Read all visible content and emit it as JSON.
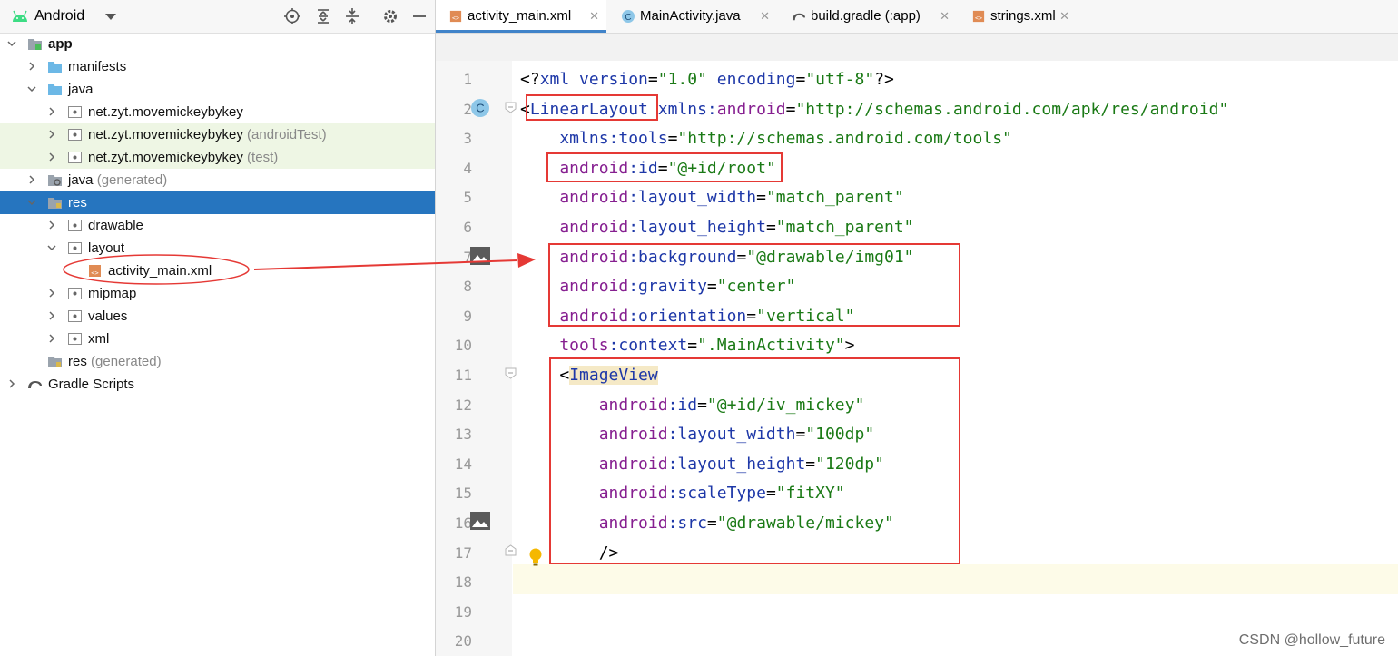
{
  "project_panel": {
    "view_name": "Android",
    "tree": [
      {
        "label": "app",
        "suffix": "",
        "level": 0,
        "expanded": true,
        "icon": "module-folder-icon",
        "bold": true
      },
      {
        "label": "manifests",
        "suffix": "",
        "level": 1,
        "expanded": false,
        "icon": "folder-icon"
      },
      {
        "label": "java",
        "suffix": "",
        "level": 1,
        "expanded": true,
        "icon": "folder-icon"
      },
      {
        "label": "net.zyt.movemickeybykey",
        "suffix": "",
        "level": 2,
        "expanded": false,
        "icon": "package-icon"
      },
      {
        "label": "net.zyt.movemickeybykey",
        "suffix": "(androidTest)",
        "level": 2,
        "expanded": false,
        "icon": "package-icon",
        "highlight": true
      },
      {
        "label": "net.zyt.movemickeybykey",
        "suffix": "(test)",
        "level": 2,
        "expanded": false,
        "icon": "package-icon",
        "highlight": true
      },
      {
        "label": "java",
        "suffix": "(generated)",
        "level": 1,
        "expanded": false,
        "icon": "generated-folder-icon"
      },
      {
        "label": "res",
        "suffix": "",
        "level": 1,
        "expanded": true,
        "icon": "res-folder-icon",
        "selected": true
      },
      {
        "label": "drawable",
        "suffix": "",
        "level": 2,
        "expanded": false,
        "icon": "package-icon"
      },
      {
        "label": "layout",
        "suffix": "",
        "level": 2,
        "expanded": true,
        "icon": "package-icon"
      },
      {
        "label": "activity_main.xml",
        "suffix": "",
        "level": 3,
        "leaf": true,
        "icon": "xml-file-icon"
      },
      {
        "label": "mipmap",
        "suffix": "",
        "level": 2,
        "expanded": false,
        "icon": "package-icon"
      },
      {
        "label": "values",
        "suffix": "",
        "level": 2,
        "expanded": false,
        "icon": "package-icon"
      },
      {
        "label": "xml",
        "suffix": "",
        "level": 2,
        "expanded": false,
        "icon": "package-icon"
      },
      {
        "label": "res",
        "suffix": "(generated)",
        "level": 1,
        "leaf": true,
        "icon": "res-folder-icon"
      },
      {
        "label": "Gradle Scripts",
        "suffix": "",
        "level": 0,
        "expanded": false,
        "icon": "gradle-icon"
      }
    ]
  },
  "editor": {
    "tabs": [
      {
        "label": "activity_main.xml",
        "icon": "xml-file-icon",
        "active": true
      },
      {
        "label": "MainActivity.java",
        "icon": "java-class-icon",
        "active": false
      },
      {
        "label": "build.gradle (:app)",
        "icon": "gradle-icon",
        "active": false
      },
      {
        "label": "strings.xml",
        "icon": "xml-file-icon",
        "active": false
      }
    ],
    "tab_close_glyph": "✕",
    "line_numbers": [
      "1",
      "2",
      "3",
      "4",
      "5",
      "6",
      "7",
      "8",
      "9",
      "10",
      "11",
      "12",
      "13",
      "14",
      "15",
      "16",
      "17",
      "18",
      "19",
      "20"
    ],
    "code": [
      [
        [
          "pn",
          "<?"
        ],
        [
          "at",
          "xml version"
        ],
        [
          "pn",
          "="
        ],
        [
          "sv",
          "\"1.0\""
        ],
        [
          "at",
          " encoding"
        ],
        [
          "pn",
          "="
        ],
        [
          "sv",
          "\"utf-8\""
        ],
        [
          "pn",
          "?>"
        ]
      ],
      [
        [
          "pn",
          "<"
        ],
        [
          "tg",
          "LinearLayout"
        ],
        [
          "at",
          " xmlns:"
        ],
        [
          "an",
          "android"
        ],
        [
          "pn",
          "="
        ],
        [
          "sv",
          "\"http://schemas.android.com/apk/res/android\""
        ]
      ],
      [
        [
          "at",
          "    xmlns:tools"
        ],
        [
          "pn",
          "="
        ],
        [
          "sv",
          "\"http://schemas.android.com/tools\""
        ]
      ],
      [
        [
          "an",
          "    android"
        ],
        [
          "at",
          ":id"
        ],
        [
          "pn",
          "="
        ],
        [
          "sv",
          "\"@+id/root\""
        ]
      ],
      [
        [
          "an",
          "    android"
        ],
        [
          "at",
          ":layout_width"
        ],
        [
          "pn",
          "="
        ],
        [
          "sv",
          "\"match_parent\""
        ]
      ],
      [
        [
          "an",
          "    android"
        ],
        [
          "at",
          ":layout_height"
        ],
        [
          "pn",
          "="
        ],
        [
          "sv",
          "\"match_parent\""
        ]
      ],
      [
        [
          "an",
          "    android"
        ],
        [
          "at",
          ":background"
        ],
        [
          "pn",
          "="
        ],
        [
          "sv",
          "\"@drawable/img01\""
        ]
      ],
      [
        [
          "an",
          "    android"
        ],
        [
          "at",
          ":gravity"
        ],
        [
          "pn",
          "="
        ],
        [
          "sv",
          "\"center\""
        ]
      ],
      [
        [
          "an",
          "    android"
        ],
        [
          "at",
          ":orientation"
        ],
        [
          "pn",
          "="
        ],
        [
          "sv",
          "\"vertical\""
        ]
      ],
      [
        [
          "an",
          "    tools"
        ],
        [
          "at",
          ":context"
        ],
        [
          "pn",
          "="
        ],
        [
          "sv",
          "\".MainActivity\""
        ],
        [
          "pn",
          ">"
        ]
      ],
      [
        [
          "pn",
          "    <"
        ],
        [
          "tg",
          "ImageView"
        ]
      ],
      [
        [
          "an",
          "        android"
        ],
        [
          "at",
          ":id"
        ],
        [
          "pn",
          "="
        ],
        [
          "sv",
          "\"@+id/iv_mickey\""
        ]
      ],
      [
        [
          "an",
          "        android"
        ],
        [
          "at",
          ":layout_width"
        ],
        [
          "pn",
          "="
        ],
        [
          "sv",
          "\"100dp\""
        ]
      ],
      [
        [
          "an",
          "        android"
        ],
        [
          "at",
          ":layout_height"
        ],
        [
          "pn",
          "="
        ],
        [
          "sv",
          "\"120dp\""
        ]
      ],
      [
        [
          "an",
          "        android"
        ],
        [
          "at",
          ":scaleType"
        ],
        [
          "pn",
          "="
        ],
        [
          "sv",
          "\"fitXY\""
        ]
      ],
      [
        [
          "an",
          "        android"
        ],
        [
          "at",
          ":src"
        ],
        [
          "pn",
          "="
        ],
        [
          "sv",
          "\"@drawable/mickey\""
        ]
      ],
      [
        [
          "pn",
          "        />"
        ]
      ],
      [],
      [],
      []
    ]
  },
  "watermark": "CSDN @hollow_future",
  "colors": {
    "selection": "#2675bf",
    "annotation_red": "#e53935",
    "tag": "#1e38a8",
    "attr_ns": "#861f90",
    "string": "#1b7a16"
  }
}
